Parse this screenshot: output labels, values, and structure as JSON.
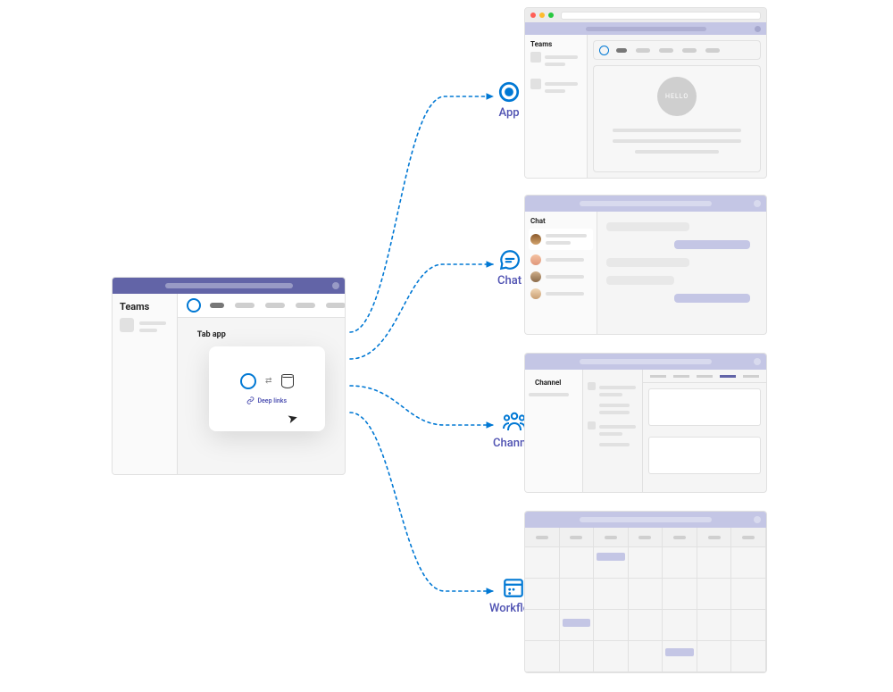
{
  "source": {
    "sidebar_title": "Teams",
    "content_title": "Tab app",
    "card_link_label": "Deep links"
  },
  "targets": {
    "app": {
      "label": "App",
      "sidebar_title": "Teams",
      "hello_text": "HELLO"
    },
    "chat": {
      "label": "Chat",
      "sidebar_title": "Chat"
    },
    "channel": {
      "label": "Channel",
      "sidebar_title": "Channel"
    },
    "workflow": {
      "label": "Workflow"
    }
  },
  "colors": {
    "accent": "#6264A7",
    "arrow": "#0078D4",
    "label": "#4F52B2"
  }
}
